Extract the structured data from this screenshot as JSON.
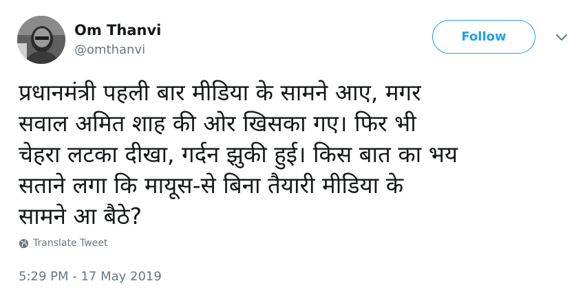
{
  "author": {
    "name": "Om Thanvi",
    "handle": "@omthanvi",
    "avatar_icon": "profile-photo"
  },
  "follow_button": {
    "label": "Follow"
  },
  "menu": {
    "icon": "chevron-down-icon"
  },
  "tweet": {
    "text": "प्रधानमंत्री पहली बार मीडिया के सामने आए, मगर\nसवाल अमित शाह की ओर खिसका गए। फिर भी\nचेहरा लटका दीखा, गर्दन झुकी हुई। किस बात का भय\nसताने लगा कि मायूस-से बिना तैयारी मीडिया के\nसामने आ बैठे?"
  },
  "translate": {
    "label": "Translate Tweet",
    "icon": "globe-icon"
  },
  "timestamp": "5:29 PM - 17 May 2019",
  "colors": {
    "accent": "#1da1f2",
    "text": "#14171a",
    "muted": "#657786"
  }
}
